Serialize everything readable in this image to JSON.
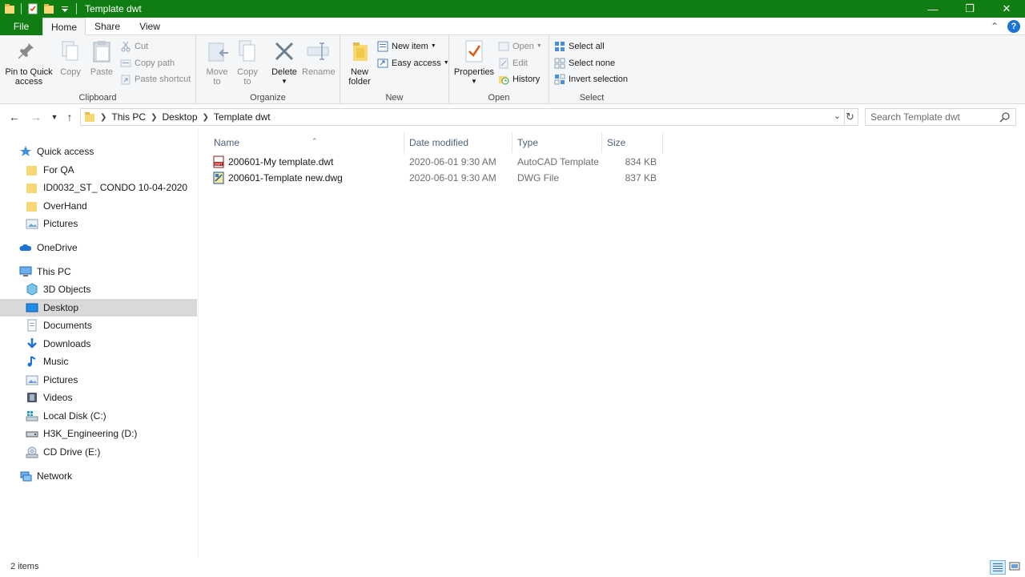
{
  "window": {
    "title": "Template dwt",
    "controls": {
      "minimize": "—",
      "maximize": "❐",
      "close": "✕"
    }
  },
  "ribbon_tabs": [
    "File",
    "Home",
    "Share",
    "View"
  ],
  "ribbon": {
    "clipboard": {
      "label": "Clipboard",
      "pin": "Pin to Quick access",
      "pin_line1": "Pin to Quick",
      "pin_line2": "access",
      "copy": "Copy",
      "paste": "Paste",
      "cut": "Cut",
      "copy_path": "Copy path",
      "paste_shortcut": "Paste shortcut"
    },
    "organize": {
      "label": "Organize",
      "move_to_line1": "Move",
      "move_to_line2": "to",
      "copy_to_line1": "Copy",
      "copy_to_line2": "to",
      "delete": "Delete",
      "rename": "Rename"
    },
    "new": {
      "label": "New",
      "new_folder_line1": "New",
      "new_folder_line2": "folder",
      "new_item": "New item",
      "easy_access": "Easy access"
    },
    "open": {
      "label": "Open",
      "properties": "Properties",
      "open": "Open",
      "edit": "Edit",
      "history": "History"
    },
    "select": {
      "label": "Select",
      "select_all": "Select all",
      "select_none": "Select none",
      "invert_selection": "Invert selection"
    }
  },
  "address": {
    "crumbs": [
      "This PC",
      "Desktop",
      "Template dwt"
    ],
    "search_placeholder": "Search Template dwt"
  },
  "nav": {
    "quick_access": "Quick access",
    "quick_items": [
      "For QA",
      "ID0032_ST_ CONDO 10-04-2020",
      "OverHand",
      "Pictures"
    ],
    "onedrive": "OneDrive",
    "this_pc": "This PC",
    "pc_items": [
      "3D Objects",
      "Desktop",
      "Documents",
      "Downloads",
      "Music",
      "Pictures",
      "Videos",
      "Local Disk (C:)",
      "H3K_Engineering (D:)",
      "CD Drive (E:)"
    ],
    "network": "Network",
    "selected": "Desktop"
  },
  "columns": {
    "name": "Name",
    "date": "Date modified",
    "type": "Type",
    "size": "Size"
  },
  "files": [
    {
      "name": "200601-My template.dwt",
      "date": "2020-06-01 9:30 AM",
      "type": "AutoCAD Template",
      "size": "834 KB",
      "icon": "dwt-file-icon"
    },
    {
      "name": "200601-Template new.dwg",
      "date": "2020-06-01 9:30 AM",
      "type": "DWG File",
      "size": "837 KB",
      "icon": "dwg-file-icon"
    }
  ],
  "status": {
    "item_count": "2 items"
  },
  "colors": {
    "title_bar": "#0f7d12",
    "selection": "#d9d9d9",
    "accent": "#1c73d6"
  }
}
